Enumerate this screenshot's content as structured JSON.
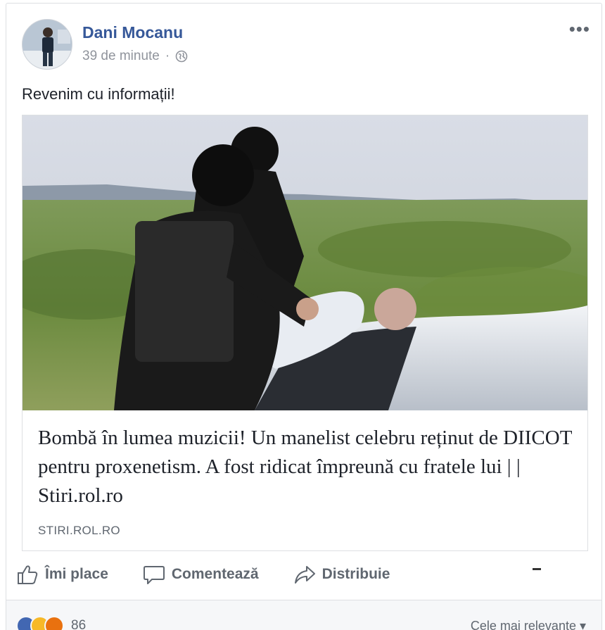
{
  "post": {
    "author": "Dani Mocanu",
    "time": "39 de minute",
    "separator": "·",
    "text": "Revenim cu informații!",
    "more": "•••"
  },
  "link": {
    "title": "Bombă în lumea muzicii! Un manelist celebru reținut de DIICOT pentru proxenetism. A fost ridicat împreună cu fratele lui | | Stiri.rol.ro",
    "domain": "STIRI.ROL.RO"
  },
  "actions": {
    "like": "Îmi place",
    "comment": "Comentează",
    "share": "Distribuie"
  },
  "reactions": {
    "count": "86",
    "sort_label": "Cele mai relevante ▾",
    "icons": [
      "like-icon",
      "haha-icon",
      "angry-icon"
    ]
  },
  "colors": {
    "author": "#365899",
    "meta": "#90949c",
    "action": "#606770",
    "like_blue": "#4267b2"
  }
}
